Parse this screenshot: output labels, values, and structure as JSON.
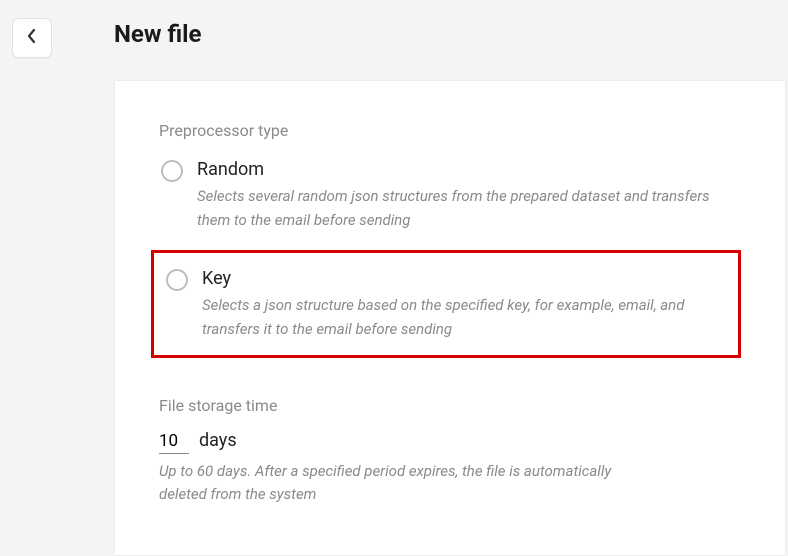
{
  "header": {
    "title": "New file",
    "back_icon": "chevron-left"
  },
  "preprocessor": {
    "section_label": "Preprocessor type",
    "options": [
      {
        "id": "random",
        "label": "Random",
        "description": "Selects several random json structures from the prepared dataset and transfers them to the email before sending",
        "selected": false,
        "highlighted": false
      },
      {
        "id": "key",
        "label": "Key",
        "description": "Selects a json structure based on the specified key, for example, email, and transfers it to the email before sending",
        "selected": false,
        "highlighted": true
      }
    ]
  },
  "storage": {
    "section_label": "File storage time",
    "value": "10",
    "unit": "days",
    "help": "Up to 60 days. After a specified period expires, the file is automatically deleted from the system"
  },
  "colors": {
    "highlight_border": "#d40000",
    "muted_text": "#8a8a8a",
    "card_bg": "#ffffff",
    "page_bg": "#f4f4f4"
  }
}
